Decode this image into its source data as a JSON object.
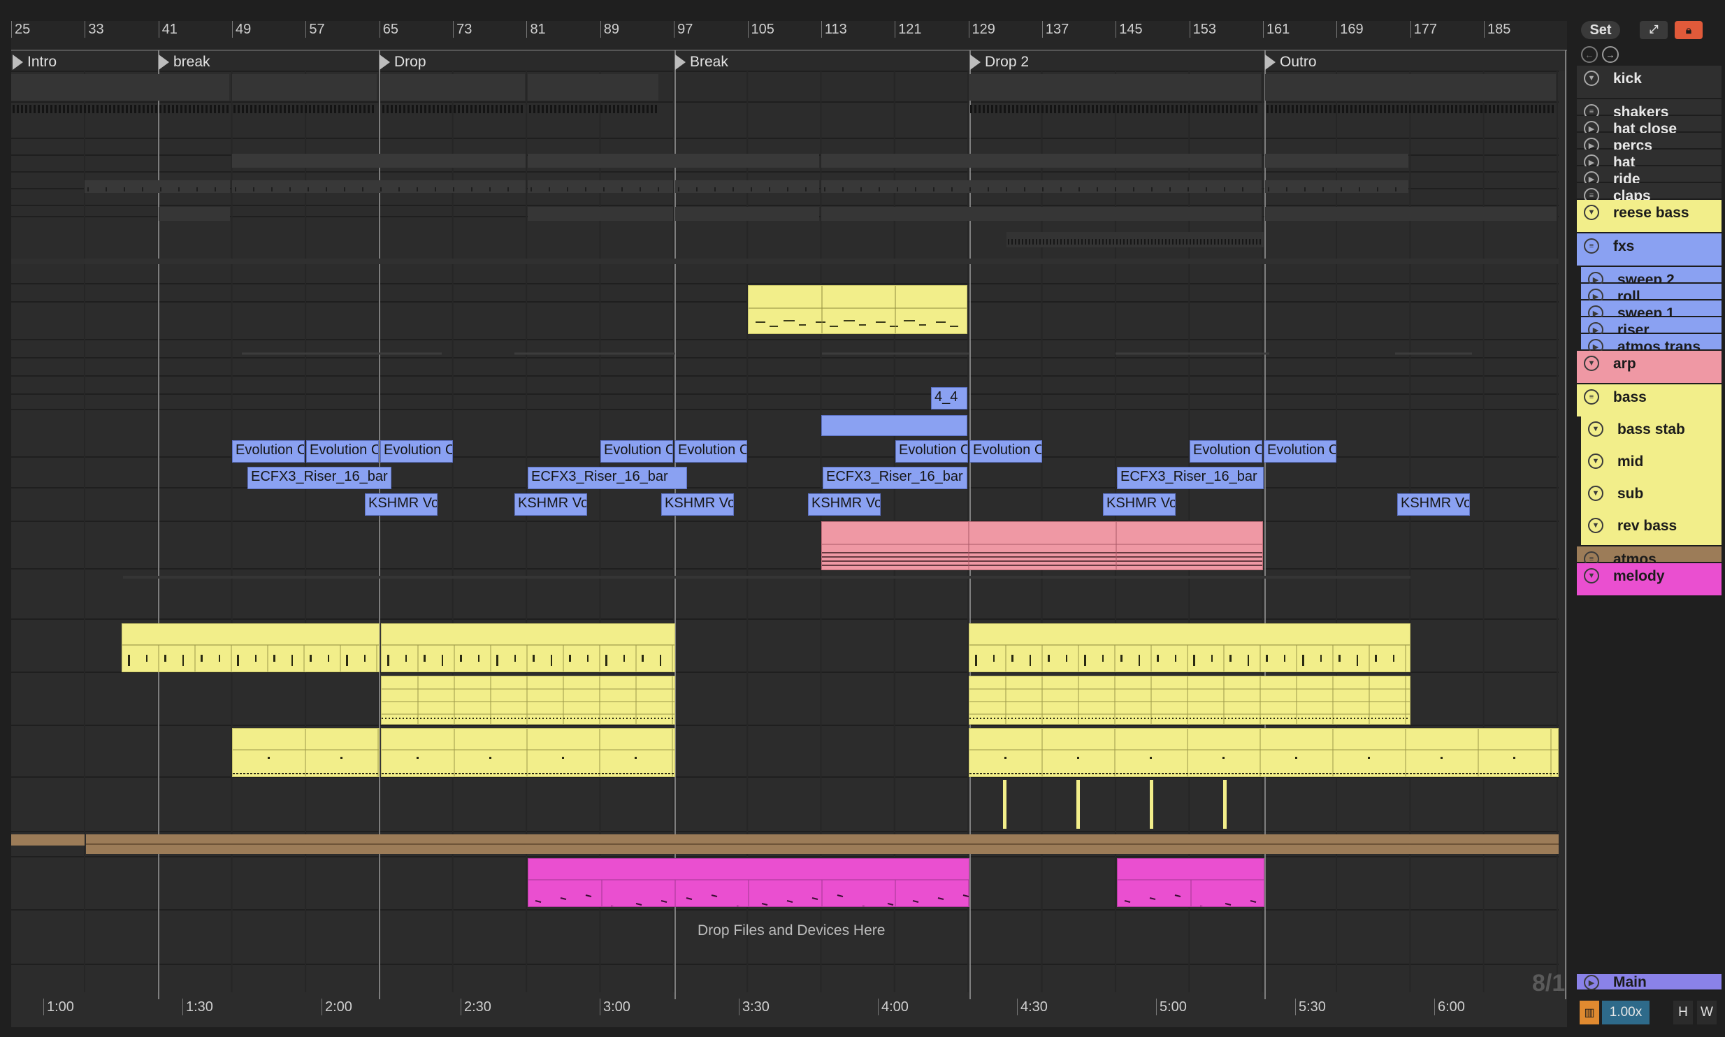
{
  "ruler": {
    "bars": [
      "25",
      "33",
      "41",
      "49",
      "57",
      "65",
      "73",
      "81",
      "89",
      "97",
      "105",
      "113",
      "121",
      "129",
      "137",
      "145",
      "153",
      "161",
      "169",
      "177",
      "185"
    ]
  },
  "locators": [
    {
      "name": "Intro"
    },
    {
      "name": "break"
    },
    {
      "name": "Drop"
    },
    {
      "name": "Break"
    },
    {
      "name": "Drop 2"
    },
    {
      "name": "Outro"
    }
  ],
  "time_ruler": {
    "labels": [
      "1:00",
      "1:30",
      "2:00",
      "2:30",
      "3:00",
      "3:30",
      "4:00",
      "4:30",
      "5:00",
      "5:30",
      "6:00"
    ]
  },
  "clips": [
    {
      "name": "Evolution C",
      "color": "#8aa1f2"
    },
    {
      "name": "Evolution C",
      "color": "#8aa1f2"
    },
    {
      "name": "Evolution C",
      "color": "#8aa1f2"
    },
    {
      "name": "Evolution C",
      "color": "#8aa1f2"
    },
    {
      "name": "Evolution C",
      "color": "#8aa1f2"
    },
    {
      "name": "Evolution C",
      "color": "#8aa1f2"
    },
    {
      "name": "Evolution C",
      "color": "#8aa1f2"
    },
    {
      "name": "Evolution C",
      "color": "#8aa1f2"
    },
    {
      "name": "Evolution C",
      "color": "#8aa1f2"
    },
    {
      "name": "ECFX3_Riser_16_bar",
      "color": "#8aa1f2"
    },
    {
      "name": "ECFX3_Riser_16_bar",
      "color": "#8aa1f2"
    },
    {
      "name": "ECFX3_Riser_16_bar",
      "color": "#8aa1f2"
    },
    {
      "name": "ECFX3_Riser_16_bar",
      "color": "#8aa1f2"
    },
    {
      "name": "KSHMR Vo",
      "color": "#8aa1f2"
    },
    {
      "name": "KSHMR Vo",
      "color": "#8aa1f2"
    },
    {
      "name": "KSHMR Vo",
      "color": "#8aa1f2"
    },
    {
      "name": "KSHMR Vo",
      "color": "#8aa1f2"
    },
    {
      "name": "KSHMR Vo",
      "color": "#8aa1f2"
    },
    {
      "name": "KSHMR Vo",
      "color": "#8aa1f2"
    },
    {
      "name": "4_4",
      "color": "#8aa1f2"
    }
  ],
  "drop_hint": "Drop Files and Devices Here",
  "time_signature": "8/1",
  "header_buttons": {
    "set": "Set"
  },
  "tracks": [
    {
      "name": "kick",
      "icon": "chevron-down",
      "color": "#2f2f2f"
    },
    {
      "name": "shakers",
      "icon": "menu",
      "color": "#2f2f2f"
    },
    {
      "name": "hat close",
      "icon": "play",
      "color": "#2f2f2f"
    },
    {
      "name": "percs",
      "icon": "play",
      "color": "#2f2f2f"
    },
    {
      "name": "hat",
      "icon": "play",
      "color": "#2f2f2f"
    },
    {
      "name": "ride",
      "icon": "play",
      "color": "#2f2f2f"
    },
    {
      "name": "claps",
      "icon": "menu",
      "color": "#2f2f2f"
    },
    {
      "name": "reese bass",
      "icon": "chevron-down",
      "color": "#f2ee8a"
    },
    {
      "name": "fxs",
      "icon": "menu",
      "color": "#8aa1f2"
    },
    {
      "name": "sweep 2",
      "icon": "play",
      "color": "#8aa1f2"
    },
    {
      "name": "roll",
      "icon": "play",
      "color": "#8aa1f2"
    },
    {
      "name": "sweep 1",
      "icon": "play",
      "color": "#8aa1f2"
    },
    {
      "name": "riser",
      "icon": "play",
      "color": "#8aa1f2"
    },
    {
      "name": "atmos trans",
      "icon": "play",
      "color": "#8aa1f2"
    },
    {
      "name": "arp",
      "icon": "chevron-down",
      "color": "#ef98a4"
    },
    {
      "name": "bass",
      "icon": "menu",
      "color": "#f2ee8a"
    },
    {
      "name": "bass stab",
      "icon": "chevron-down",
      "color": "#f2ee8a"
    },
    {
      "name": "mid",
      "icon": "chevron-down",
      "color": "#f2ee8a"
    },
    {
      "name": "sub",
      "icon": "chevron-down",
      "color": "#f2ee8a"
    },
    {
      "name": "rev bass",
      "icon": "chevron-down",
      "color": "#f2ee8a"
    },
    {
      "name": "atmos",
      "icon": "menu",
      "color": "#9c7c58"
    },
    {
      "name": "melody",
      "icon": "chevron-down",
      "color": "#ea4fd0"
    }
  ],
  "main_track": {
    "name": "Main",
    "color": "#8a82e8"
  },
  "bottom": {
    "zoom": "1.00x",
    "h": "H",
    "w": "W"
  },
  "colors": {
    "accent_yellow": "#f2ee8a",
    "accent_blue": "#8aa1f2",
    "accent_pink": "#ef98a4",
    "accent_magenta": "#ea4fd0",
    "atmos_brown": "#9c7c58",
    "lock_red": "#e05a3a"
  }
}
